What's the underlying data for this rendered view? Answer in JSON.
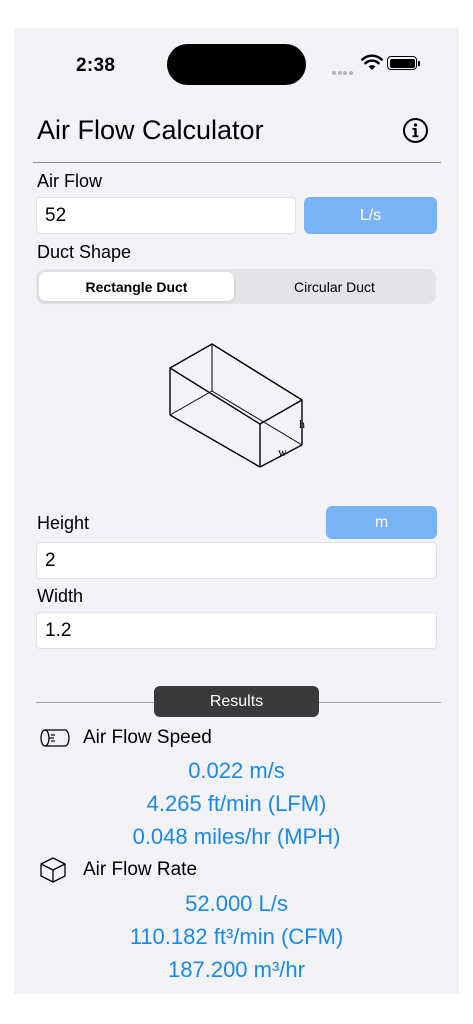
{
  "status": {
    "time": "2:38"
  },
  "header": {
    "title": "Air Flow Calculator"
  },
  "airflow": {
    "label": "Air Flow",
    "value": "52",
    "unit": "L/s"
  },
  "duct": {
    "label": "Duct Shape",
    "options": [
      "Rectangle Duct",
      "Circular Duct"
    ],
    "selected": "Rectangle Duct",
    "diagram_labels": {
      "height": "h",
      "width": "w"
    }
  },
  "dimensions": {
    "height_label": "Height",
    "height_value": "2",
    "unit": "m",
    "width_label": "Width",
    "width_value": "1.2"
  },
  "results": {
    "label": "Results",
    "speed": {
      "title": "Air Flow Speed",
      "values": [
        "0.022 m/s",
        "4.265 ft/min (LFM)",
        "0.048 miles/hr (MPH)"
      ]
    },
    "rate": {
      "title": "Air Flow Rate",
      "values": [
        "52.000 L/s",
        "110.182 ft³/min (CFM)",
        "187.200 m³/hr"
      ]
    }
  },
  "colors": {
    "accent": "#1a8ae5",
    "button": "#78b4f5",
    "background": "#f2f2f7",
    "pill": "#3a3a3c"
  }
}
